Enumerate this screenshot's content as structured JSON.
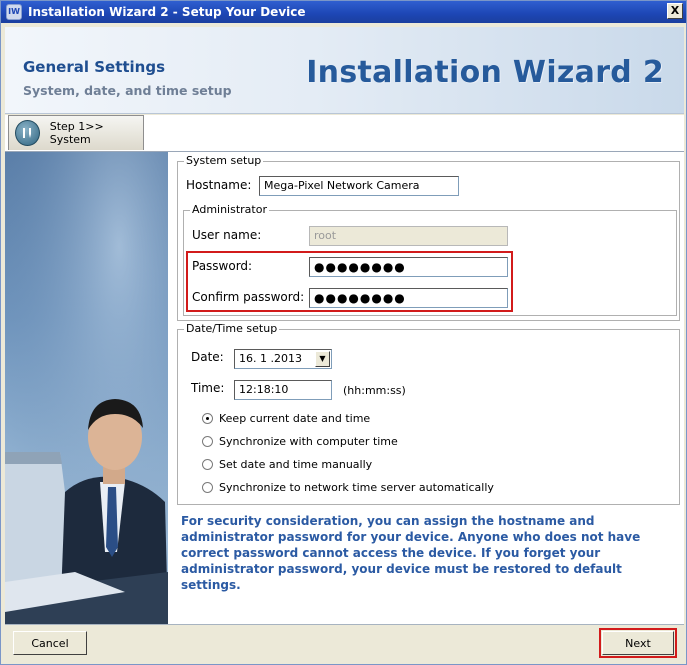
{
  "window": {
    "title": "Installation Wizard 2 - Setup Your Device",
    "app_icon_text": "IW",
    "close_symbol": "X"
  },
  "header": {
    "title": "General Settings",
    "subtitle": "System, date, and time setup",
    "brand": "Installation Wizard 2"
  },
  "step_tab": {
    "label": "Step 1>> System",
    "icon": "wrench-screwdriver-icon"
  },
  "system_setup": {
    "legend": "System setup",
    "hostname_label": "Hostname:",
    "hostname_value": "Mega-Pixel Network Camera",
    "admin": {
      "legend": "Administrator",
      "username_label": "User name:",
      "username_value": "root",
      "password_label": "Password:",
      "password_value": "●●●●●●●●",
      "confirm_label": "Confirm password:",
      "confirm_value": "●●●●●●●●"
    }
  },
  "datetime_setup": {
    "legend": "Date/Time setup",
    "date_label": "Date:",
    "date_value": "16. 1 .2013",
    "time_label": "Time:",
    "time_value": "12:18:10",
    "time_hint": "(hh:mm:ss)",
    "options": [
      {
        "label": "Keep current date and time",
        "selected": true
      },
      {
        "label": "Synchronize with computer time",
        "selected": false
      },
      {
        "label": "Set date and time manually",
        "selected": false
      },
      {
        "label": "Synchronize to network time server automatically",
        "selected": false
      }
    ]
  },
  "info_text": "For security consideration, you can assign the hostname and administrator password for your device. Anyone who does not have correct password cannot access the device. If you forget your administrator password, your device must be restored to default settings.",
  "buttons": {
    "cancel": "Cancel",
    "next": "Next"
  },
  "colors": {
    "accent": "#1f4e90",
    "highlight_box": "#d21b1b",
    "info_text": "#2b5aa3"
  }
}
